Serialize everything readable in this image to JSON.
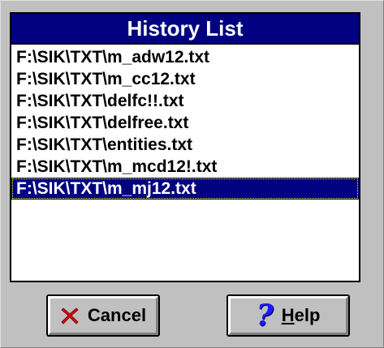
{
  "dialog": {
    "title": "History List"
  },
  "history": {
    "items": [
      "F:\\SIK\\TXT\\m_adw12.txt",
      "F:\\SIK\\TXT\\m_cc12.txt",
      "F:\\SIK\\TXT\\delfc!!.txt",
      "F:\\SIK\\TXT\\delfree.txt",
      "F:\\SIK\\TXT\\entities.txt",
      "F:\\SIK\\TXT\\m_mcd12!.txt",
      "F:\\SIK\\TXT\\m_mj12.txt"
    ],
    "selected_index": 6
  },
  "buttons": {
    "cancel": {
      "label": "Cancel",
      "icon": "red-x-icon",
      "color": "#e00000"
    },
    "help": {
      "accel": "H",
      "rest": "elp",
      "icon": "question-mark-icon",
      "glyph": "?",
      "color": "#1a1aff"
    }
  },
  "colors": {
    "title_bg": "#000080",
    "selection_bg": "#000080",
    "face": "#c0c0c0"
  }
}
